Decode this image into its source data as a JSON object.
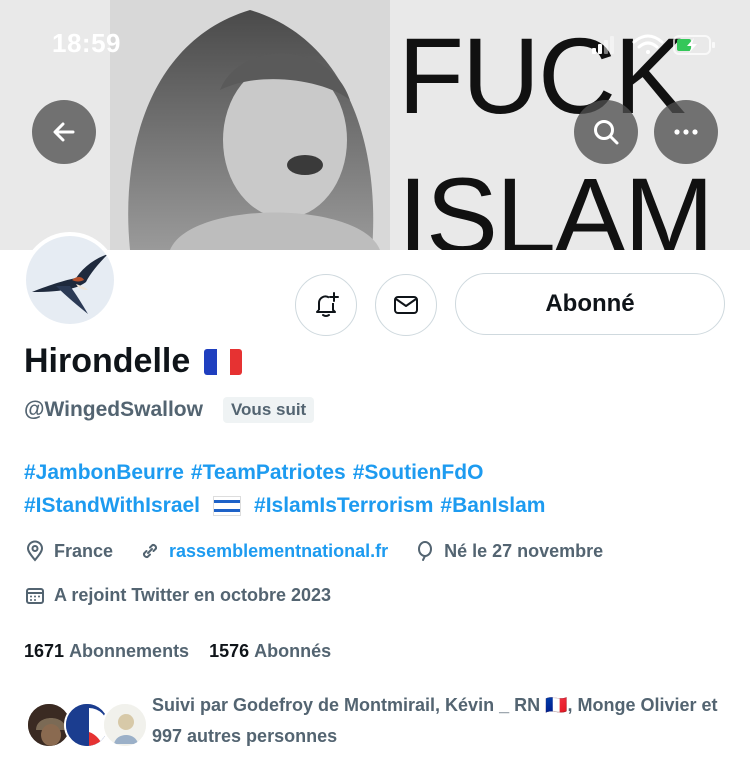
{
  "status_bar": {
    "time": "18:59"
  },
  "banner": {
    "line1": "FUCK",
    "line2": "ISLAM"
  },
  "profile": {
    "display_name": "Hirondelle",
    "display_flag": "🇫🇷",
    "handle": "@WingedSwallow",
    "follows_you": "Vous suit",
    "follow_button": "Abonné",
    "bio_line1": [
      "#JambonBeurre",
      "#TeamPatriotes",
      "#SoutienFdO"
    ],
    "bio_line2": [
      "#IStandWithIsrael",
      "#IslamIsTerrorism",
      "#BanIslam"
    ],
    "location": "France",
    "website": "rassemblementnational.fr",
    "birthday": "Né le 27 novembre",
    "joined": "A rejoint Twitter en octobre 2023",
    "following_count": "1671",
    "following_label": "Abonnements",
    "followers_count": "1576",
    "followers_label": "Abonnés",
    "followed_by": "Suivi par Godefroy de Montmirail, Kévin _ RN 🇫🇷, Monge Olivier et 997 autres personnes"
  },
  "colors": {
    "link": "#1d9bf0",
    "muted": "#536471",
    "text": "#0f1419",
    "border": "#cfd9de"
  },
  "icons": [
    "back-arrow-icon",
    "search-icon",
    "more-icon",
    "notification-bell-icon",
    "envelope-icon",
    "location-icon",
    "link-icon",
    "birthday-balloon-icon",
    "calendar-icon"
  ]
}
